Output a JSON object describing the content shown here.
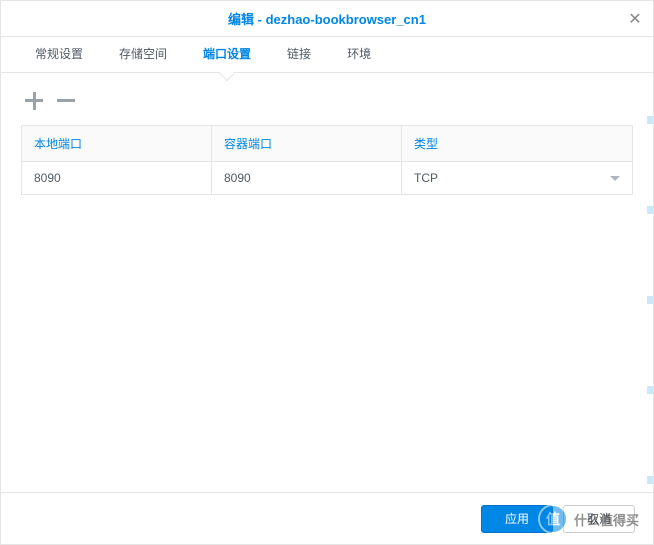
{
  "titlebar": {
    "title": "编辑 - dezhao-bookbrowser_cn1"
  },
  "tabs": [
    {
      "label": "常规设置",
      "active": false
    },
    {
      "label": "存储空间",
      "active": false
    },
    {
      "label": "端口设置",
      "active": true
    },
    {
      "label": "链接",
      "active": false
    },
    {
      "label": "环境",
      "active": false
    }
  ],
  "table": {
    "headers": {
      "local_port": "本地端口",
      "container_port": "容器端口",
      "type": "类型"
    },
    "rows": [
      {
        "local_port": "8090",
        "container_port": "8090",
        "type": "TCP"
      }
    ]
  },
  "footer": {
    "apply": "应用",
    "cancel": "取消"
  },
  "watermark": {
    "badge": "值",
    "text": "什么值得买"
  }
}
